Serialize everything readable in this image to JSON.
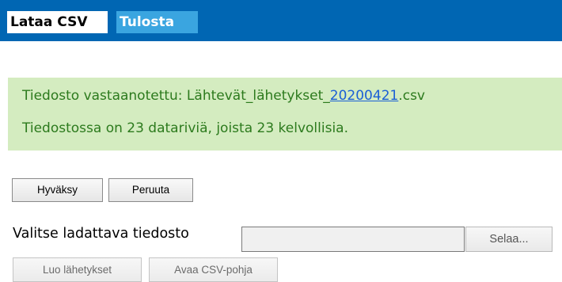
{
  "tabs": [
    {
      "label": "Lataa CSV",
      "active": true
    },
    {
      "label": "Tulosta",
      "active": false
    }
  ],
  "notice": {
    "line1_prefix": "Tiedosto vastaanotettu: Lähtevät_lähetykset_",
    "line1_link": "20200421",
    "line1_suffix": ".csv",
    "line2": "Tiedostossa on 23 datariviä, joista 23 kelvollisia."
  },
  "actions": {
    "accept_label": "Hyväksy",
    "cancel_label": "Peruuta"
  },
  "file_upload": {
    "label": "Valitse ladattava tiedosto",
    "value": "",
    "browse_label": "Selaa..."
  },
  "bottom_actions": {
    "create_label": "Luo lähetykset",
    "template_label": "Avaa CSV-pohja"
  },
  "colors": {
    "header_bar": "#0066b3",
    "inactive_tab": "#3aa5e0",
    "notice_background": "#d4ecc0",
    "notice_text": "#2c7a1d",
    "link": "#1a5fd6"
  }
}
